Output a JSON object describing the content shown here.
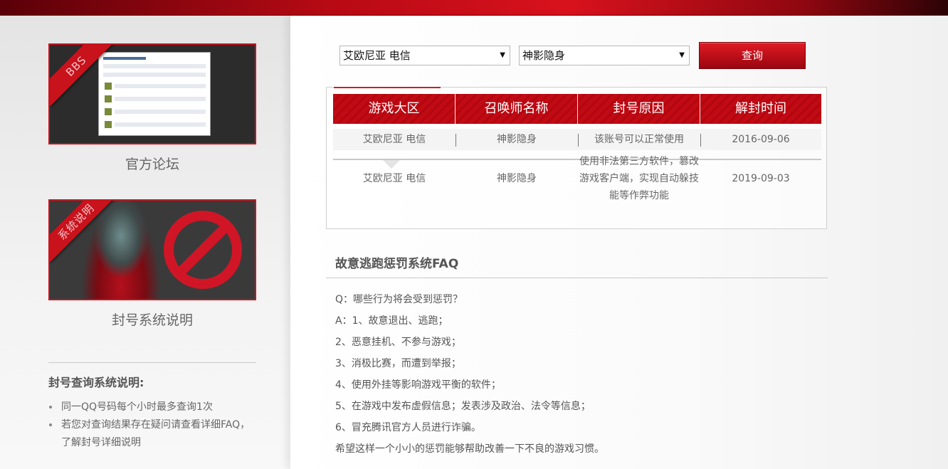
{
  "sidebar": {
    "cards": [
      {
        "ribbon": "BBS",
        "caption": "官方论坛"
      },
      {
        "ribbon": "系统说明",
        "caption": "封号系统说明"
      }
    ],
    "notes_title": "封号查询系统说明:",
    "notes": [
      "同一QQ号码每个小时最多查询1次",
      "若您对查询结果存在疑问请查看详细FAQ，了解封号详细说明"
    ]
  },
  "query": {
    "region_select": "艾欧尼亚 电信",
    "name_select": "神影隐身",
    "button": "查询"
  },
  "results": {
    "headers": [
      "游戏大区",
      "召唤师名称",
      "封号原因",
      "解封时间"
    ],
    "rows": [
      [
        "艾欧尼亚 电信",
        "神影隐身",
        "该账号可以正常使用",
        "2016-09-06"
      ],
      [
        "艾欧尼亚 电信",
        "神影隐身",
        "使用非法第三方软件，篡改游戏客户端，实现自动躲技能等作弊功能",
        "2019-09-03"
      ]
    ]
  },
  "faq": {
    "title": "故意逃跑惩罚系统FAQ",
    "lines": [
      "Q：哪些行为将会受到惩罚？",
      "A：1、故意退出、逃跑；",
      "2、恶意挂机、不参与游戏；",
      "3、消极比赛，而遭到举报；",
      "4、使用外挂等影响游戏平衡的软件；",
      "5、在游戏中发布虚假信息；发表涉及政治、法令等信息；",
      "6、冒充腾讯官方人员进行诈骗。",
      "希望这样一个小小的惩罚能够帮助改善一下不良的游戏习惯。"
    ]
  },
  "colors": {
    "accent": "#c00a14",
    "banner": "#b80a14"
  }
}
